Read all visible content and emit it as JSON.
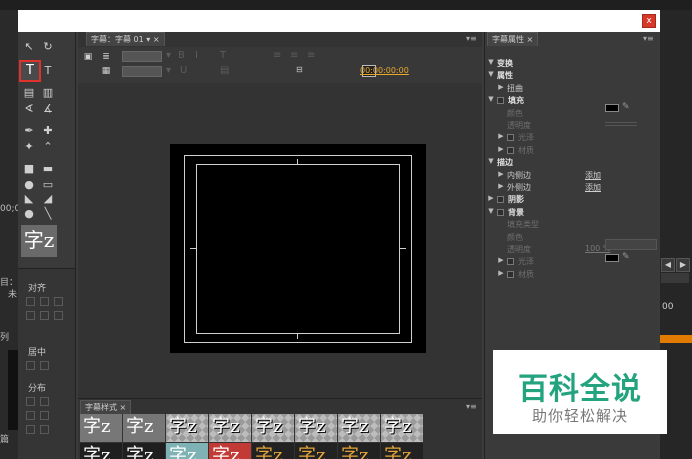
{
  "background_app": {
    "timecode": "00",
    "left_labels": [
      "00;0",
      "目：",
      "未",
      "列",
      "篇"
    ],
    "right_buttons": [
      "◀",
      "▶"
    ]
  },
  "window": {
    "close_label": "x"
  },
  "tools": {
    "items": [
      "selection",
      "rotation",
      "type",
      "vertical-type",
      "area-type",
      "vertical-area-type",
      "path-type",
      "vertical-path-type",
      "pen",
      "add-anchor",
      "delete-anchor",
      "convert-anchor",
      "rectangle",
      "rounded-rectangle",
      "clipped-rectangle",
      "rounded-corner-rectangle",
      "wedge",
      "arc",
      "ellipse",
      "line"
    ],
    "selected_glyph": "T",
    "vertical_glyph": "T",
    "sample_label": "字z"
  },
  "align_panel": {
    "title": "对齐",
    "center_label": "居中",
    "distribute_label": "分布"
  },
  "designer": {
    "tab_label": "字幕：字幕 01",
    "timecode": "00:00:00:00"
  },
  "styles_panel": {
    "tab_label": "字幕样式",
    "swatch_text": [
      "字z",
      "字z",
      "字z",
      "字z",
      "字z",
      "字z",
      "字z",
      "字z"
    ],
    "row2_text": [
      "字z",
      "字z",
      "字z",
      "字z",
      "字z",
      "字z",
      "字z",
      "字z"
    ]
  },
  "properties": {
    "tab_label": "字幕属性",
    "rows": [
      {
        "name": "变换",
        "level": 0,
        "arrow": "▼",
        "style": "bold"
      },
      {
        "name": "属性",
        "level": 0,
        "arrow": "▼",
        "style": "bold"
      },
      {
        "name": "扭曲",
        "level": 1,
        "arrow": "▶",
        "style": "normal"
      },
      {
        "name": "填充",
        "level": 0,
        "arrow": "▼",
        "style": "bold",
        "check": true
      },
      {
        "name": "颜色",
        "level": 1,
        "arrow": "",
        "style": "dim"
      },
      {
        "name": "透明度",
        "level": 1,
        "arrow": "",
        "style": "dim"
      },
      {
        "name": "光泽",
        "level": 1,
        "arrow": "▶",
        "style": "dim",
        "check": true
      },
      {
        "name": "材质",
        "level": 1,
        "arrow": "▶",
        "style": "dim",
        "check": true
      },
      {
        "name": "描边",
        "level": 0,
        "arrow": "▼",
        "style": "bold"
      },
      {
        "name": "内侧边",
        "level": 1,
        "arrow": "▶",
        "style": "normal",
        "link": "添加"
      },
      {
        "name": "外侧边",
        "level": 1,
        "arrow": "▶",
        "style": "normal",
        "link": "添加"
      },
      {
        "name": "阴影",
        "level": 0,
        "arrow": "▶",
        "style": "bold",
        "check": true
      },
      {
        "name": "背景",
        "level": 0,
        "arrow": "▼",
        "style": "bold",
        "check": true
      },
      {
        "name": "填充类型",
        "level": 1,
        "arrow": "",
        "style": "dim"
      },
      {
        "name": "颜色",
        "level": 1,
        "arrow": "",
        "style": "dim"
      },
      {
        "name": "透明度",
        "level": 1,
        "arrow": "",
        "style": "dim",
        "link": "100 %",
        "linkdim": true
      },
      {
        "name": "光泽",
        "level": 1,
        "arrow": "▶",
        "style": "dim",
        "check": true
      },
      {
        "name": "材质",
        "level": 1,
        "arrow": "▶",
        "style": "dim",
        "check": true
      }
    ]
  },
  "watermark": {
    "title": "百科全说",
    "subtitle": "助你轻松解决"
  },
  "colors": {
    "accent_red": "#e0322c",
    "timecode": "#e8a92b",
    "watermark_green": "#23a37e"
  }
}
